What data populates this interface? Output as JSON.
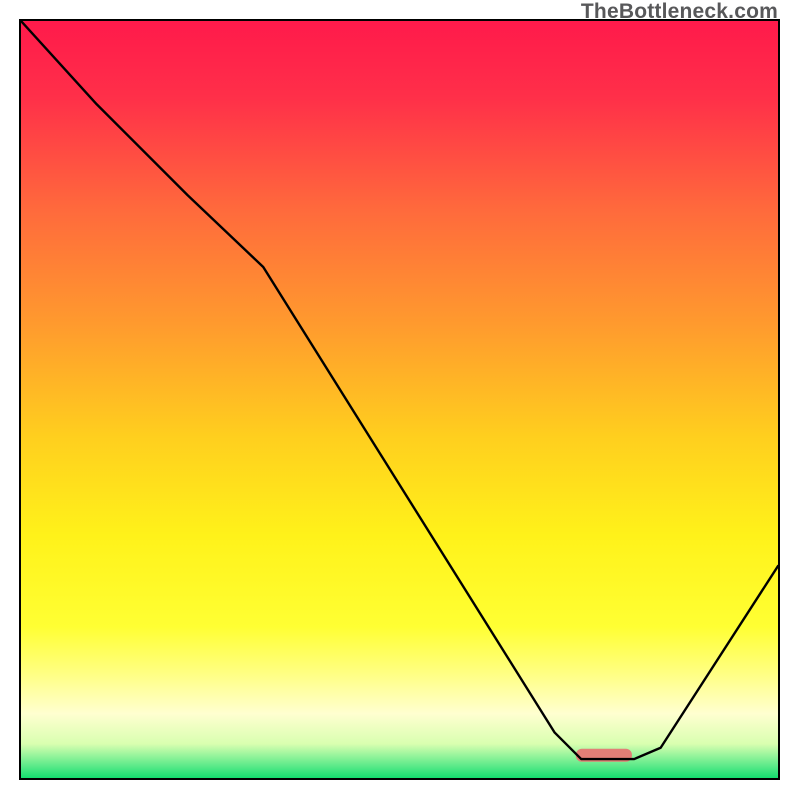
{
  "watermark": "TheBottleneck.com",
  "chart_data": {
    "type": "line",
    "title": "",
    "xlabel": "",
    "ylabel": "",
    "xlim": [
      0,
      100
    ],
    "ylim": [
      0,
      100
    ],
    "grid": false,
    "legend": false,
    "gradient_stops": [
      {
        "offset": 0.0,
        "color": "#ff1a4b"
      },
      {
        "offset": 0.1,
        "color": "#ff2f49"
      },
      {
        "offset": 0.25,
        "color": "#ff6a3c"
      },
      {
        "offset": 0.4,
        "color": "#ff9a2e"
      },
      {
        "offset": 0.55,
        "color": "#ffcf1e"
      },
      {
        "offset": 0.68,
        "color": "#fff21a"
      },
      {
        "offset": 0.8,
        "color": "#ffff33"
      },
      {
        "offset": 0.86,
        "color": "#ffff80"
      },
      {
        "offset": 0.915,
        "color": "#ffffd0"
      },
      {
        "offset": 0.955,
        "color": "#d9ffb0"
      },
      {
        "offset": 0.985,
        "color": "#57e988"
      },
      {
        "offset": 1.0,
        "color": "#14de6e"
      }
    ],
    "series": [
      {
        "name": "bottleneck-curve",
        "x": [
          0.0,
          10.0,
          22.0,
          32.0,
          70.5,
          74.0,
          81.0,
          84.5,
          100.0
        ],
        "y": [
          100.0,
          89.0,
          77.0,
          67.5,
          6.0,
          2.5,
          2.5,
          4.0,
          28.0
        ]
      }
    ],
    "marker": {
      "name": "highlight-bar",
      "x_center": 77.0,
      "width": 7.4,
      "y": 3.0,
      "color": "#e27f76"
    }
  }
}
